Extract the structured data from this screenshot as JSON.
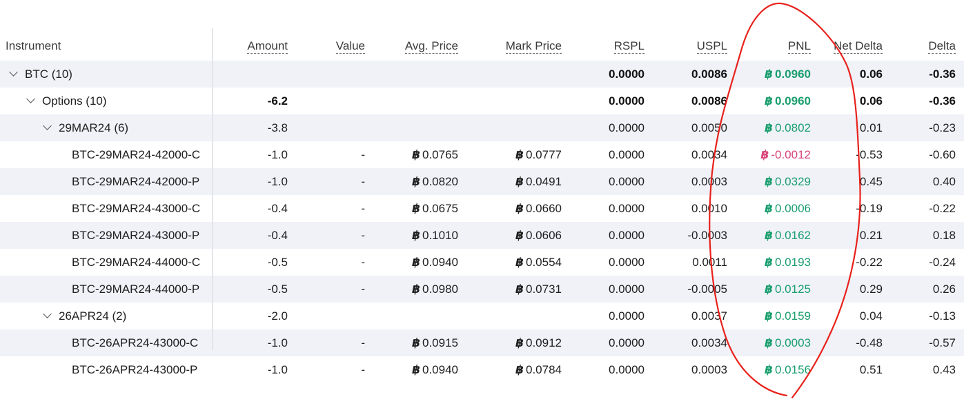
{
  "columns": {
    "instrument": "Instrument",
    "amount": "Amount",
    "value": "Value",
    "avg_price": "Avg. Price",
    "mark_price": "Mark Price",
    "rspl": "RSPL",
    "uspl": "USPL",
    "pnl": "PNL",
    "net_delta": "Net Delta",
    "delta": "Delta"
  },
  "currency_symbol": "฿",
  "colors": {
    "positive": "#1a9e6e",
    "negative": "#d8457a",
    "annotation": "#e8211b"
  },
  "rows": [
    {
      "instrument": "BTC (10)",
      "level": 0,
      "group": true,
      "amount": "",
      "value": "",
      "avg": "",
      "mark": "",
      "rspl": "0.0000",
      "uspl": "0.0086",
      "pnl": "0.0960",
      "pnl_sign": "pos",
      "net": "0.06",
      "delta": "-0.36",
      "bold": true
    },
    {
      "instrument": "Options (10)",
      "level": 1,
      "group": true,
      "amount": "-6.2",
      "value": "",
      "avg": "",
      "mark": "",
      "rspl": "0.0000",
      "uspl": "0.0086",
      "pnl": "0.0960",
      "pnl_sign": "pos",
      "net": "0.06",
      "delta": "-0.36",
      "bold": true
    },
    {
      "instrument": "29MAR24 (6)",
      "level": 2,
      "group": true,
      "amount": "-3.8",
      "value": "",
      "avg": "",
      "mark": "",
      "rspl": "0.0000",
      "uspl": "0.0050",
      "pnl": "0.0802",
      "pnl_sign": "pos",
      "net": "0.01",
      "delta": "-0.23",
      "bold": false
    },
    {
      "instrument": "BTC-29MAR24-42000-C",
      "level": 3,
      "group": false,
      "amount": "-1.0",
      "value": "-",
      "avg": "0.0765",
      "mark": "0.0777",
      "rspl": "0.0000",
      "uspl": "0.0034",
      "pnl": "-0.0012",
      "pnl_sign": "neg",
      "net": "-0.53",
      "delta": "-0.60",
      "bold": false
    },
    {
      "instrument": "BTC-29MAR24-42000-P",
      "level": 3,
      "group": false,
      "amount": "-1.0",
      "value": "-",
      "avg": "0.0820",
      "mark": "0.0491",
      "rspl": "0.0000",
      "uspl": "0.0003",
      "pnl": "0.0329",
      "pnl_sign": "pos",
      "net": "0.45",
      "delta": "0.40",
      "bold": false
    },
    {
      "instrument": "BTC-29MAR24-43000-C",
      "level": 3,
      "group": false,
      "amount": "-0.4",
      "value": "-",
      "avg": "0.0675",
      "mark": "0.0660",
      "rspl": "0.0000",
      "uspl": "0.0010",
      "pnl": "0.0006",
      "pnl_sign": "pos",
      "net": "-0.19",
      "delta": "-0.22",
      "bold": false
    },
    {
      "instrument": "BTC-29MAR24-43000-P",
      "level": 3,
      "group": false,
      "amount": "-0.4",
      "value": "-",
      "avg": "0.1010",
      "mark": "0.0606",
      "rspl": "0.0000",
      "uspl": "-0.0003",
      "pnl": "0.0162",
      "pnl_sign": "pos",
      "net": "0.21",
      "delta": "0.18",
      "bold": false
    },
    {
      "instrument": "BTC-29MAR24-44000-C",
      "level": 3,
      "group": false,
      "amount": "-0.5",
      "value": "-",
      "avg": "0.0940",
      "mark": "0.0554",
      "rspl": "0.0000",
      "uspl": "0.0011",
      "pnl": "0.0193",
      "pnl_sign": "pos",
      "net": "-0.22",
      "delta": "-0.24",
      "bold": false
    },
    {
      "instrument": "BTC-29MAR24-44000-P",
      "level": 3,
      "group": false,
      "amount": "-0.5",
      "value": "-",
      "avg": "0.0980",
      "mark": "0.0731",
      "rspl": "0.0000",
      "uspl": "-0.0005",
      "pnl": "0.0125",
      "pnl_sign": "pos",
      "net": "0.29",
      "delta": "0.26",
      "bold": false
    },
    {
      "instrument": "26APR24 (2)",
      "level": 2,
      "group": true,
      "amount": "-2.0",
      "value": "",
      "avg": "",
      "mark": "",
      "rspl": "0.0000",
      "uspl": "0.0037",
      "pnl": "0.0159",
      "pnl_sign": "pos",
      "net": "0.04",
      "delta": "-0.13",
      "bold": false
    },
    {
      "instrument": "BTC-26APR24-43000-C",
      "level": 3,
      "group": false,
      "amount": "-1.0",
      "value": "-",
      "avg": "0.0915",
      "mark": "0.0912",
      "rspl": "0.0000",
      "uspl": "0.0034",
      "pnl": "0.0003",
      "pnl_sign": "pos",
      "net": "-0.48",
      "delta": "-0.57",
      "bold": false
    },
    {
      "instrument": "BTC-26APR24-43000-P",
      "level": 3,
      "group": false,
      "amount": "-1.0",
      "value": "-",
      "avg": "0.0940",
      "mark": "0.0784",
      "rspl": "0.0000",
      "uspl": "0.0003",
      "pnl": "0.0156",
      "pnl_sign": "pos",
      "net": "0.51",
      "delta": "0.43",
      "bold": false
    }
  ]
}
